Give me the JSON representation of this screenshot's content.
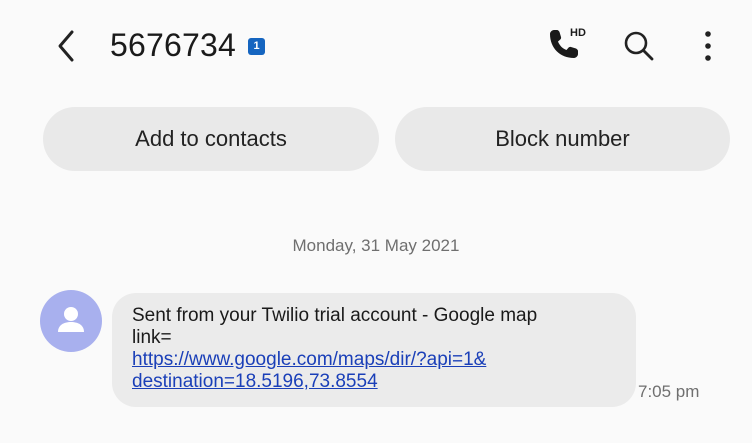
{
  "header": {
    "title": "5676734",
    "sim_badge": "1",
    "call_hd_label": "HD"
  },
  "actions": {
    "add_contacts": "Add to contacts",
    "block_number": "Block number"
  },
  "conversation": {
    "date": "Monday, 31 May 2021",
    "message": {
      "text_line1": "Sent from your Twilio trial account - Google map",
      "text_line2": "link=",
      "link_line1": "https://www.google.com/maps/dir/?api=1&",
      "link_line2": "destination=18.5196,73.8554",
      "time": "7:05 pm"
    }
  },
  "colors": {
    "avatar": "#a8b0ee",
    "link": "#1a3fb8",
    "sim_badge": "#1565c0",
    "pill_bg": "#e9e9e9",
    "bubble_bg": "#ebebeb"
  }
}
